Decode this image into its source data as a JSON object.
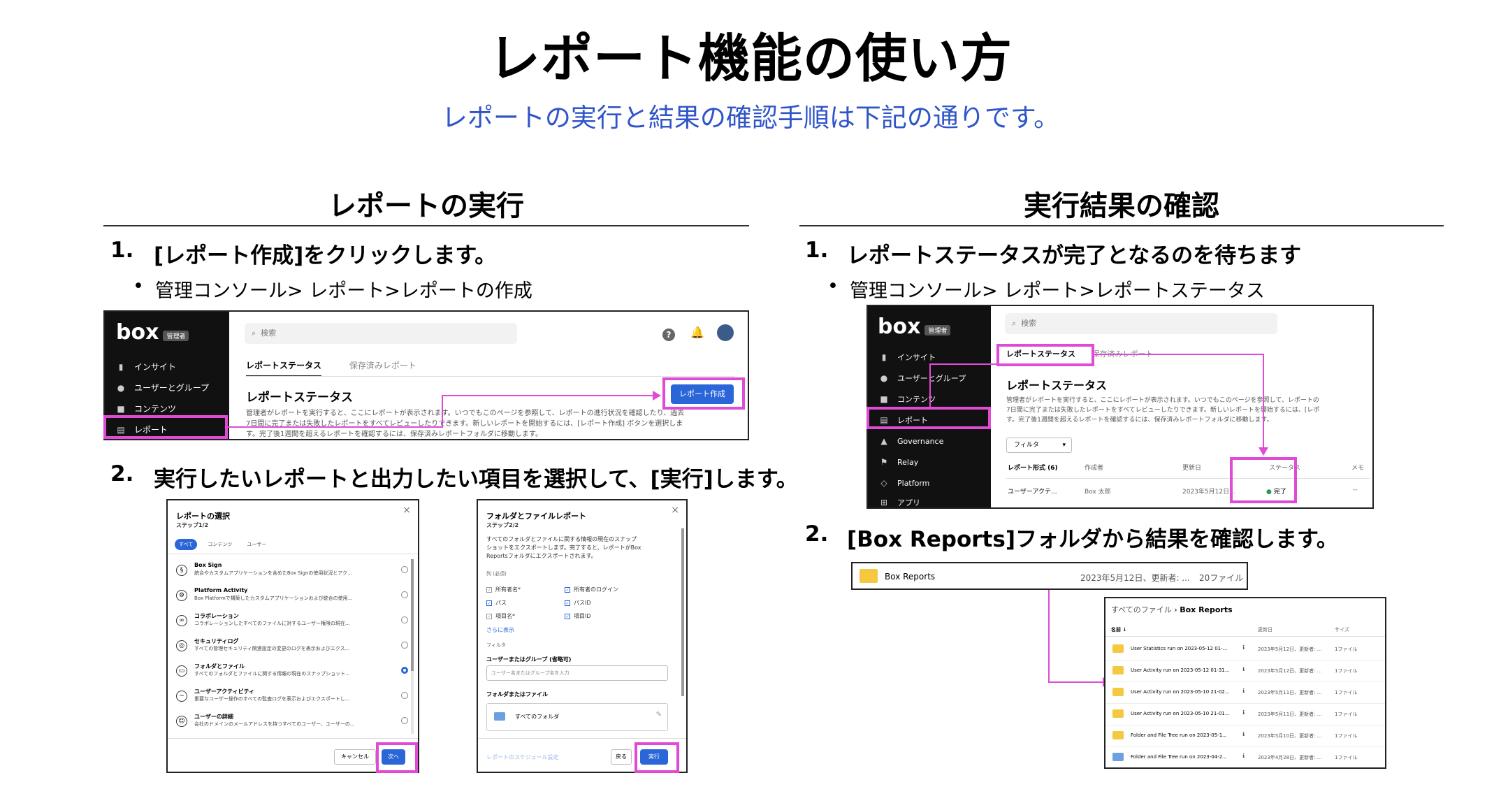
{
  "title": "レポート機能の使い方",
  "subtitle": "レポートの実行と結果の確認手順は下記の通りです。",
  "left": {
    "heading": "レポートの実行",
    "step1": {
      "num": "1.",
      "text": "[レポート作成]をクリックします。",
      "bullet": "管理コンソール> レポート>レポートの作成"
    },
    "step2": {
      "num": "2.",
      "text": "実行したいレポートと出力したい項目を選択して、[実行]します。"
    }
  },
  "right": {
    "heading": "実行結果の確認",
    "step1": {
      "num": "1.",
      "text": "レポートステータスが完了となるのを待ちます",
      "bullet": "管理コンソール> レポート>レポートステータス"
    },
    "step2": {
      "num": "2.",
      "text": "[Box Reports]フォルダから結果を確認します。"
    }
  },
  "console": {
    "logo": "box",
    "badge": "管理者",
    "search_placeholder": "検索",
    "nav": [
      "インサイト",
      "ユーザーとグループ",
      "コンテンツ",
      "レポート"
    ],
    "nav_right": [
      "インサイト",
      "ユーザーとグループ",
      "コンテンツ",
      "レポート",
      "Governance",
      "Relay",
      "Platform",
      "アプリ"
    ],
    "tab_status": "レポートステータス",
    "tab_saved": "保存済みレポート",
    "page_heading": "レポートステータス",
    "desc1": "管理者がレポートを実行すると、ここにレポートが表示されます。いつでもこのページを参照して、レポートの進行状況を確認したり、過去",
    "desc2": "7日間に完了または失敗したレポートをすべてレビューしたりできます。新しいレポートを開始するには、[レポート作成] ボタンを選択しま",
    "desc3": "す。完了後1週間を超えるレポートを確認するには、保存済みレポートフォルダに移動します。",
    "desc_r1": "管理者がレポートを実行すると、ここにレポートが表示されます。いつでもこのページを参照して、レポートの",
    "desc_r2": "7日間に完了または失敗したレポートをすべてレビューしたりできます。新しいレポートを開始するには、[レポ",
    "desc_r3": "す。完了後1週間を超えるレポートを確認するには、保存済みレポートフォルダに移動します。",
    "create_btn": "レポート作成",
    "filter": "フィルタ",
    "cols": [
      "レポート形式 (6)",
      "作成者",
      "更新日",
      "ステータス",
      "メモ"
    ],
    "row": [
      "ユーザーアクテ...",
      "Box 太郎",
      "2023年5月12日...",
      "完了",
      "--"
    ]
  },
  "dialog1": {
    "title": "レポートの選択",
    "step": "ステップ1/2",
    "chips": [
      "すべて",
      "コンテンツ",
      "ユーザー"
    ],
    "options": [
      {
        "icon": "sign-icon",
        "name": "Box Sign",
        "desc": "統合やカスタムアプリケーションを含めたBox Signの使用状況とアク..."
      },
      {
        "icon": "platform-icon",
        "name": "Platform Activity",
        "desc": "Box Platformで構築したカスタムアプリケーションおよび統合の使用..."
      },
      {
        "icon": "collab-icon",
        "name": "コラボレーション",
        "desc": "コラボレーションしたすべてのファイルに対するユーザー権限の現在..."
      },
      {
        "icon": "security-icon",
        "name": "セキュリティログ",
        "desc": "すべての管理セキュリティ関連設定の変更のログを表示およびエクス..."
      },
      {
        "icon": "folder-file-icon",
        "name": "フォルダとファイル",
        "desc": "すべてのフォルダとファイルに関する情報の現在のスナップショット..."
      },
      {
        "icon": "activity-icon",
        "name": "ユーザーアクティビティ",
        "desc": "重要なユーザー操作のすべての監査ログを表示およびエクスポートし..."
      },
      {
        "icon": "user-detail-icon",
        "name": "ユーザーの詳細",
        "desc": "会社のドメインのメールアドレスを持つすべてのユーザー、ユーザーの..."
      }
    ],
    "cancel": "キャンセル",
    "next": "次へ"
  },
  "dialog2": {
    "title": "フォルダとファイルレポート",
    "step": "ステップ2/2",
    "desc1": "すべてのフォルダとファイルに関する情報の現在のスナップ",
    "desc2": "ショットをエクスポートします。完了すると、レポートがBox",
    "desc3": "Reportsフォルダにエクスポートされます。",
    "columns_label": "列 (必須)",
    "cols_left": [
      "所有者名*",
      "パス",
      "項目名*"
    ],
    "cols_right": [
      "所有者のログイン",
      "パスID",
      "項目ID"
    ],
    "more": "さらに表示",
    "filter_label": "フィルタ",
    "group_label": "ユーザーまたはグループ (省略可)",
    "group_placeholder": "ユーザー名またはグループ名を入力",
    "folder_label": "フォルダまたはファイル",
    "all_folders": "すべてのフォルダ",
    "schedule": "レポートのスケジュール設定",
    "back": "戻る",
    "run": "実行"
  },
  "boxreports": {
    "name": "Box Reports",
    "meta": "2023年5月12日、更新者: ...",
    "count": "20ファイル",
    "breadcrumb_root": "すべてのファイル",
    "breadcrumb_sep": "›",
    "breadcrumb_current": "Box Reports",
    "col_name": "名前 ↓",
    "col_updated": "更新日",
    "col_size": "サイズ",
    "files": [
      {
        "name": "User Statistics run on 2023-05-12 01-...",
        "date": "2023年5月12日、更新者: ...",
        "size": "1ファイル"
      },
      {
        "name": "User Activity run on 2023-05-12 01-31...",
        "date": "2023年5月12日、更新者: ...",
        "size": "1ファイル"
      },
      {
        "name": "User Activity run on 2023-05-10 21-02...",
        "date": "2023年5月11日、更新者: ...",
        "size": "1ファイル"
      },
      {
        "name": "User Activity run on 2023-05-10 21-01...",
        "date": "2023年5月11日、更新者: ...",
        "size": "1ファイル"
      },
      {
        "name": "Folder and File Tree run on 2023-05-1...",
        "date": "2023年5月10日、更新者: ...",
        "size": "1ファイル"
      },
      {
        "name": "Folder and File Tree run on 2023-04-2...",
        "date": "2023年4月28日、更新者: ...",
        "size": "1ファイル"
      }
    ]
  },
  "colors": {
    "accent": "#2f55c9",
    "highlight": "#e04bd6",
    "button": "#2a66d8",
    "sidebar": "#111111"
  }
}
